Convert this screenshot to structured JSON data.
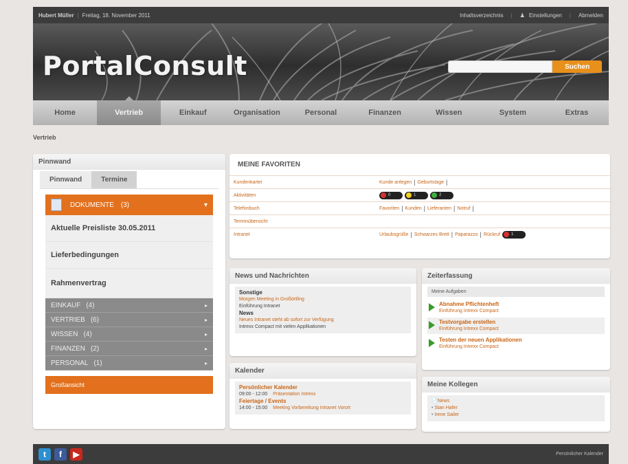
{
  "topbar": {
    "user": "Hubert Müller",
    "date": "Freitag, 18. November 2011",
    "links": [
      "Inhaltsverzeichnis",
      "Einstellungen",
      "Abmelden"
    ]
  },
  "header": {
    "logo": "PortalConsult",
    "search_placeholder": "",
    "search_button": "Suchen"
  },
  "nav": {
    "tabs": [
      "Home",
      "Vertrieb",
      "Einkauf",
      "Organisation",
      "Personal",
      "Finanzen",
      "Wissen",
      "System",
      "Extras"
    ],
    "active": "Vertrieb"
  },
  "breadcrumb": "Vertrieb",
  "pinnwand": {
    "title": "Pinnwand",
    "tabs": [
      "Pinnwand",
      "Termine"
    ],
    "documents_label": "DOKUMENTE",
    "documents_count": "(3)",
    "documents": [
      "Aktuelle Preisliste 30.05.2011",
      "Lieferbedingungen",
      "Rahmenvertrag"
    ],
    "categories": [
      {
        "label": "EINKAUF",
        "count": "(4)"
      },
      {
        "label": "VERTRIEB",
        "count": "(6)"
      },
      {
        "label": "WISSEN",
        "count": "(4)"
      },
      {
        "label": "FINANZEN",
        "count": "(2)"
      },
      {
        "label": "PERSONAL",
        "count": "(1)"
      }
    ],
    "large_view": "Großansicht"
  },
  "favoriten": {
    "title": "MEINE FAVORITEN",
    "rows": [
      {
        "label": "Kundenkartei",
        "links": [
          "Kunde anlegen",
          "Geburtstage"
        ]
      },
      {
        "label": "Aktivitäten",
        "badges": [
          "0",
          "1",
          "2"
        ]
      },
      {
        "label": "Telefonbuch",
        "links": [
          "Favoriten",
          "Kunden",
          "Lieferanten",
          "Notruf"
        ]
      },
      {
        "label": "Terminübersicht",
        "links": []
      },
      {
        "label": "Intranet",
        "links": [
          "Urlaubsgrüße",
          "Schwarzes Brett",
          "Paparazzo",
          "Rückruf"
        ],
        "badge": "1"
      }
    ]
  },
  "news": {
    "title": "News und Nachrichten",
    "section1": "Sonstige",
    "item1a": "Morgen Meeting in Großörtling",
    "item1b": "Einführung Intranet",
    "section2": "News",
    "item2a": "Neues Intranet steht ab sofort zur Verfügung",
    "item2b": "Intrexx Compact mit vielen Applikationen"
  },
  "kalender": {
    "title": "Kalender",
    "section1": "Persönlicher Kalender",
    "e1_time": "09:00 - 12:00",
    "e1_text": "Präsentation Intrexx",
    "section2": "Feiertage / Events",
    "e2_time": "14:00 - 15:00",
    "e2_text": "Meeting Vorbereitung Intranet Vorort"
  },
  "zeit": {
    "title": "Zeiterfassung",
    "subtitle": "Meine Aufgaben",
    "tasks": [
      {
        "title": "Abnahme Pflichtenheft",
        "sub": "Einführung Intrexx Compact"
      },
      {
        "title": "Testvorgabe erstellen",
        "sub": "Einführung Intrexx Compact"
      },
      {
        "title": "Testen der neuen Applikationen",
        "sub": "Einführung Intrexx Compact"
      }
    ]
  },
  "kollegen": {
    "title": "Meine Kollegen",
    "items": [
      "News",
      "Stan Hafer",
      "Irene Sailer"
    ]
  },
  "footer": {
    "right": "Persönlicher Kalender"
  },
  "colors": {
    "accent": "#e2701c",
    "dark": "#3c3c3c"
  }
}
